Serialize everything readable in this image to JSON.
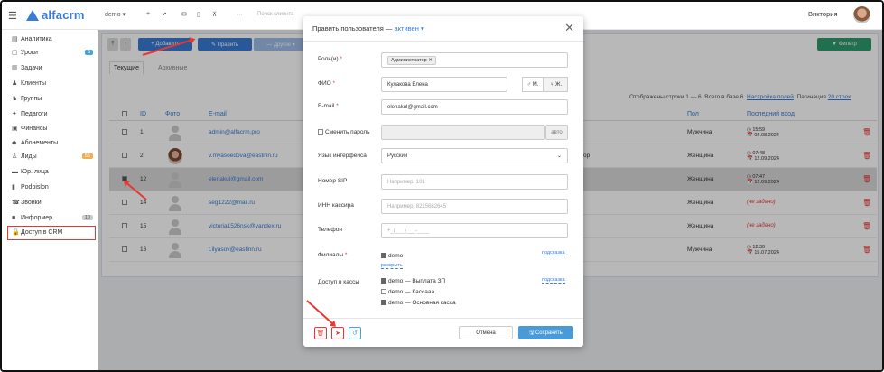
{
  "app": {
    "logo_text": "alfacrm",
    "accent": "#3a7bd5"
  },
  "topbar": {
    "branch": "demo ▾",
    "search_placeholder": "Поиск клиента",
    "user_name": "Виктория"
  },
  "sidebar": {
    "items": [
      {
        "label": "Аналитика",
        "icon": "chart-icon"
      },
      {
        "label": "Уроки",
        "icon": "calendar-icon",
        "badge": "5"
      },
      {
        "label": "Задачи",
        "icon": "tasks-icon"
      },
      {
        "label": "Клиенты",
        "icon": "client-icon"
      },
      {
        "label": "Группы",
        "icon": "group-icon"
      },
      {
        "label": "Педагоги",
        "icon": "teacher-icon"
      },
      {
        "label": "Финансы",
        "icon": "finance-icon"
      },
      {
        "label": "Абонементы",
        "icon": "ticket-icon"
      },
      {
        "label": "Лиды",
        "icon": "lead-icon",
        "badge": "55"
      },
      {
        "label": "Юр. лица",
        "icon": "building-icon"
      },
      {
        "label": "Podpislon",
        "icon": "document-icon"
      },
      {
        "label": "Звонки",
        "icon": "phone-icon"
      },
      {
        "label": "Информер",
        "icon": "informer-icon",
        "badge": "10"
      },
      {
        "label": "Доступ в CRM",
        "icon": "lock-icon"
      }
    ]
  },
  "toolbar": {
    "add": "+ Добавить",
    "edit": "✎ Править",
    "other": "— Другое ▾",
    "filter": "▼ Фильтр"
  },
  "tabs": [
    "Текущие",
    "Архивные"
  ],
  "table": {
    "info": "Отображены строки 1 — 6. Всего в базе 6.",
    "settings_link": "Настройка полей",
    "pagination_label": "Пагинация",
    "pagination_value": "20 строк",
    "columns": {
      "id": "ID",
      "photo": "Фото",
      "email": "E-mail",
      "gender": "Пол",
      "last_login": "Последний вход"
    },
    "rows": [
      {
        "id": "1",
        "email": "admin@alfacrm.pro",
        "gender": "Мужчина",
        "time": "◷ 15:59",
        "date": "📅 02.08.2024"
      },
      {
        "id": "2",
        "email": "v.myasoedova@eastinn.ru",
        "gender": "Женщина",
        "time": "◷ 07:48",
        "date": "📅 12.09.2024"
      },
      {
        "id": "12",
        "email": "elenakul@gmail.com",
        "gender": "Женщина",
        "time": "◷ 07:47",
        "date": "📅 12.09.2024"
      },
      {
        "id": "14",
        "email": "seg1222@mail.ru",
        "gender": "Женщина",
        "never": "(не задано)"
      },
      {
        "id": "15",
        "email": "victoria1526nsk@yandex.ru",
        "gender": "Женщина",
        "never": "(не задано)"
      },
      {
        "id": "16",
        "email": "t.ilyasov@eastinn.ru",
        "gender": "Мужчина",
        "time": "◷ 12:30",
        "date": "📅 15.07.2024"
      }
    ],
    "extra_cell": "ор"
  },
  "modal": {
    "title": "Править пользователя",
    "status": "активен ▾",
    "labels": {
      "roles": "Роль(и)",
      "fio": "ФИО",
      "email": "E-mail",
      "change_password": "Сменить пароль",
      "language": "Язык интерфейса",
      "sip": "Номер SIP",
      "inn": "ИНН кассира",
      "phone": "Телефон",
      "branches": "Филиалы",
      "cashbox": "Доступ в кассы"
    },
    "role_chip": "Администратор ✕",
    "fio_value": "Кулакова Елена",
    "gender_m": "♂ М.",
    "gender_f": "♀ Ж.",
    "email_value": "elenakul@gmail.com",
    "password_auto": "авто",
    "language_value": "Русский",
    "sip_placeholder": "Например, 101",
    "inn_placeholder": "Например, 8215682645",
    "phone_placeholder": "+_(___)___-____",
    "branch_item": "demo",
    "expand_link": "раскрыть",
    "hint_link": "подсказка",
    "cashboxes": [
      {
        "label": "demo — Выплата ЗП",
        "checked": true
      },
      {
        "label": "demo — Кассааа",
        "checked": false
      },
      {
        "label": "demo — Основная касса",
        "checked": true
      }
    ],
    "cancel": "Отмена",
    "save": "🖫 Сохранить"
  }
}
